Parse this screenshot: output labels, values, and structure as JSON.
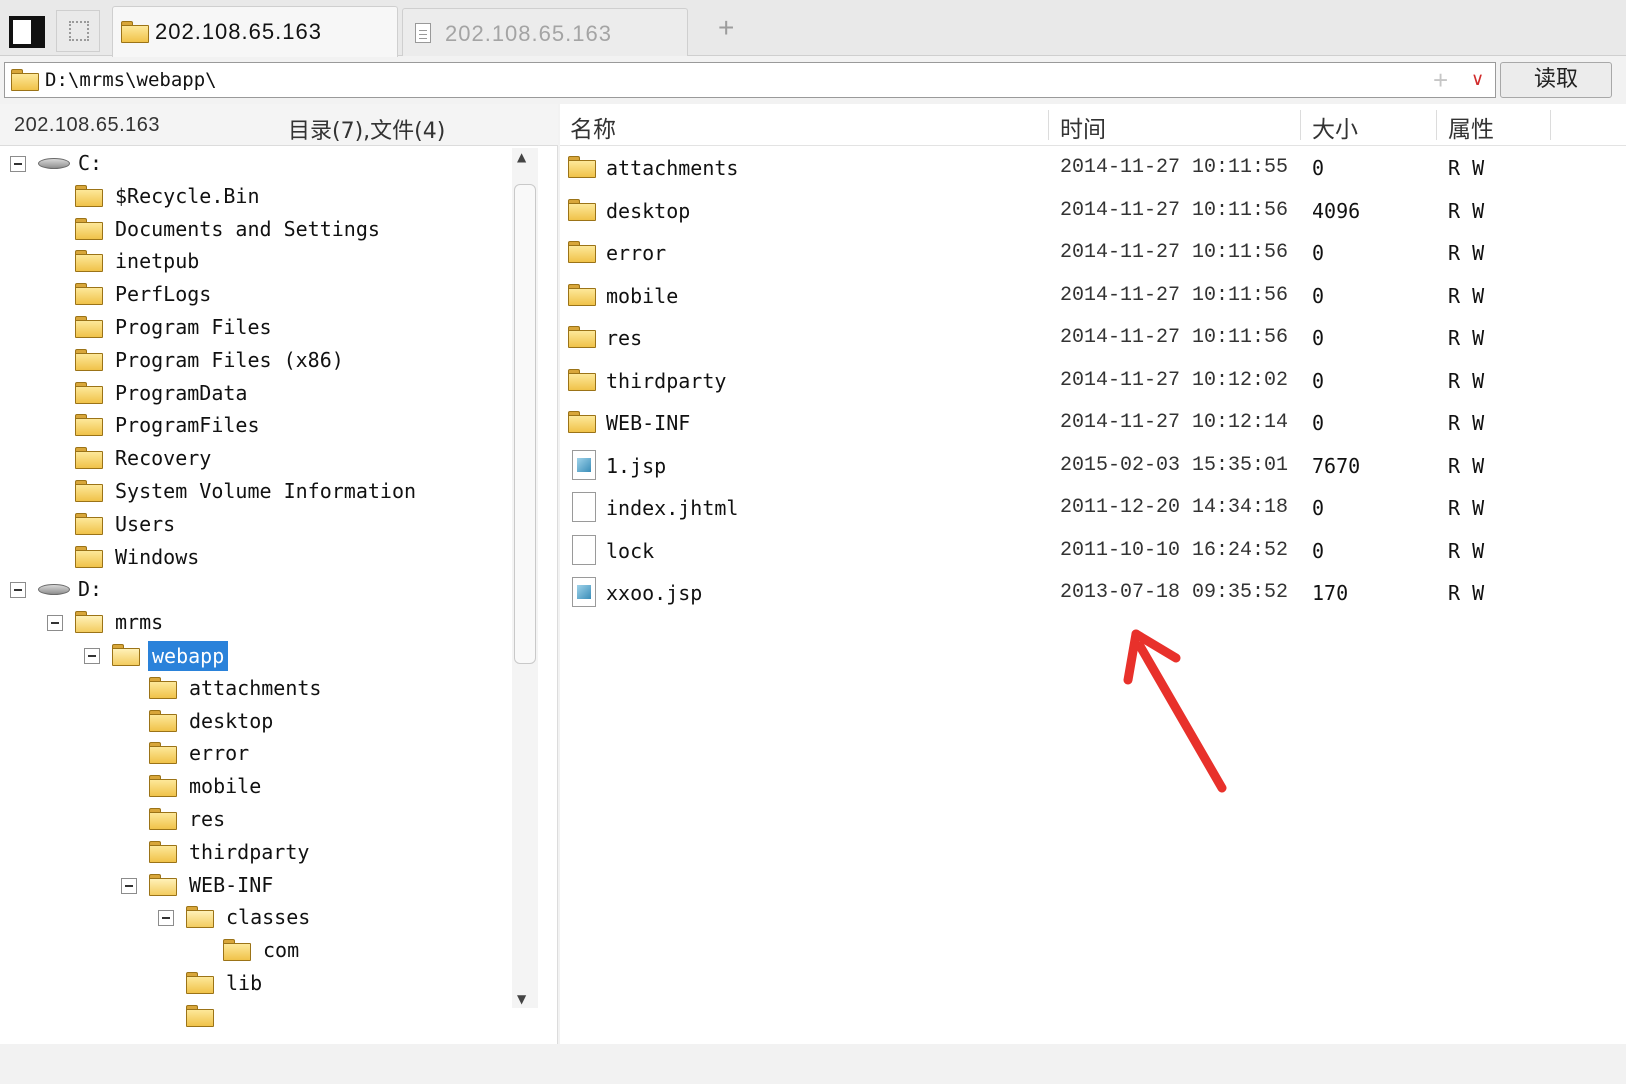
{
  "tabs": {
    "active_label": "202.108.65.163",
    "inactive_label": "202.108.65.163",
    "add_icon": "+"
  },
  "address": {
    "value": "D:\\mrms\\webapp\\",
    "add_icon": "+",
    "dropdown_icon": "chevron-down",
    "read_button": "读取"
  },
  "left_panel": {
    "host": "202.108.65.163",
    "summary": "目录(7),文件(4)",
    "tree": [
      {
        "label": "C:",
        "type": "drive",
        "depth": 0,
        "expanded": true
      },
      {
        "label": "$Recycle.Bin",
        "type": "folder",
        "depth": 1
      },
      {
        "label": "Documents and Settings",
        "type": "folder",
        "depth": 1
      },
      {
        "label": "inetpub",
        "type": "folder",
        "depth": 1
      },
      {
        "label": "PerfLogs",
        "type": "folder",
        "depth": 1
      },
      {
        "label": "Program Files",
        "type": "folder",
        "depth": 1
      },
      {
        "label": "Program Files (x86)",
        "type": "folder",
        "depth": 1
      },
      {
        "label": "ProgramData",
        "type": "folder",
        "depth": 1
      },
      {
        "label": "ProgramFiles",
        "type": "folder",
        "depth": 1
      },
      {
        "label": "Recovery",
        "type": "folder",
        "depth": 1
      },
      {
        "label": "System Volume Information",
        "type": "folder",
        "depth": 1
      },
      {
        "label": "Users",
        "type": "folder",
        "depth": 1
      },
      {
        "label": "Windows",
        "type": "folder",
        "depth": 1
      },
      {
        "label": "D:",
        "type": "drive",
        "depth": 0,
        "expanded": true
      },
      {
        "label": "mrms",
        "type": "folder",
        "depth": 1,
        "expanded": true
      },
      {
        "label": "webapp",
        "type": "folder",
        "depth": 2,
        "expanded": true,
        "selected": true
      },
      {
        "label": "attachments",
        "type": "folder",
        "depth": 3
      },
      {
        "label": "desktop",
        "type": "folder",
        "depth": 3
      },
      {
        "label": "error",
        "type": "folder",
        "depth": 3
      },
      {
        "label": "mobile",
        "type": "folder",
        "depth": 3
      },
      {
        "label": "res",
        "type": "folder",
        "depth": 3
      },
      {
        "label": "thirdparty",
        "type": "folder",
        "depth": 3
      },
      {
        "label": "WEB-INF",
        "type": "folder",
        "depth": 3,
        "expanded": true
      },
      {
        "label": "classes",
        "type": "folder",
        "depth": 4,
        "expanded": true
      },
      {
        "label": "com",
        "type": "folder",
        "depth": 5
      },
      {
        "label": "lib",
        "type": "folder",
        "depth": 4
      },
      {
        "label": "",
        "type": "folder",
        "depth": 4
      }
    ]
  },
  "file_list": {
    "columns": {
      "name": "名称",
      "time": "时间",
      "size": "大小",
      "attr": "属性"
    },
    "rows": [
      {
        "name": "attachments",
        "time": "2014-11-27 10:11:55",
        "size": "0",
        "attr": "R W",
        "kind": "folder"
      },
      {
        "name": "desktop",
        "time": "2014-11-27 10:11:56",
        "size": "4096",
        "attr": "R W",
        "kind": "folder"
      },
      {
        "name": "error",
        "time": "2014-11-27 10:11:56",
        "size": "0",
        "attr": "R W",
        "kind": "folder"
      },
      {
        "name": "mobile",
        "time": "2014-11-27 10:11:56",
        "size": "0",
        "attr": "R W",
        "kind": "folder"
      },
      {
        "name": "res",
        "time": "2014-11-27 10:11:56",
        "size": "0",
        "attr": "R W",
        "kind": "folder"
      },
      {
        "name": "thirdparty",
        "time": "2014-11-27 10:12:02",
        "size": "0",
        "attr": "R W",
        "kind": "folder"
      },
      {
        "name": "WEB-INF",
        "time": "2014-11-27 10:12:14",
        "size": "0",
        "attr": "R W",
        "kind": "folder"
      },
      {
        "name": "1.jsp",
        "time": "2015-02-03 15:35:01",
        "size": "7670",
        "attr": "R W",
        "kind": "jsp"
      },
      {
        "name": "index.jhtml",
        "time": "2011-12-20 14:34:18",
        "size": "0",
        "attr": "R W",
        "kind": "file"
      },
      {
        "name": "lock",
        "time": "2011-10-10 16:24:52",
        "size": "0",
        "attr": "R W",
        "kind": "file"
      },
      {
        "name": "xxoo.jsp",
        "time": "2013-07-18 09:35:52",
        "size": "170",
        "attr": "R W",
        "kind": "jsp"
      }
    ]
  },
  "colors": {
    "selection": "#2a82da",
    "annotation_arrow": "#e8312b",
    "folder": "#f0c24a"
  }
}
